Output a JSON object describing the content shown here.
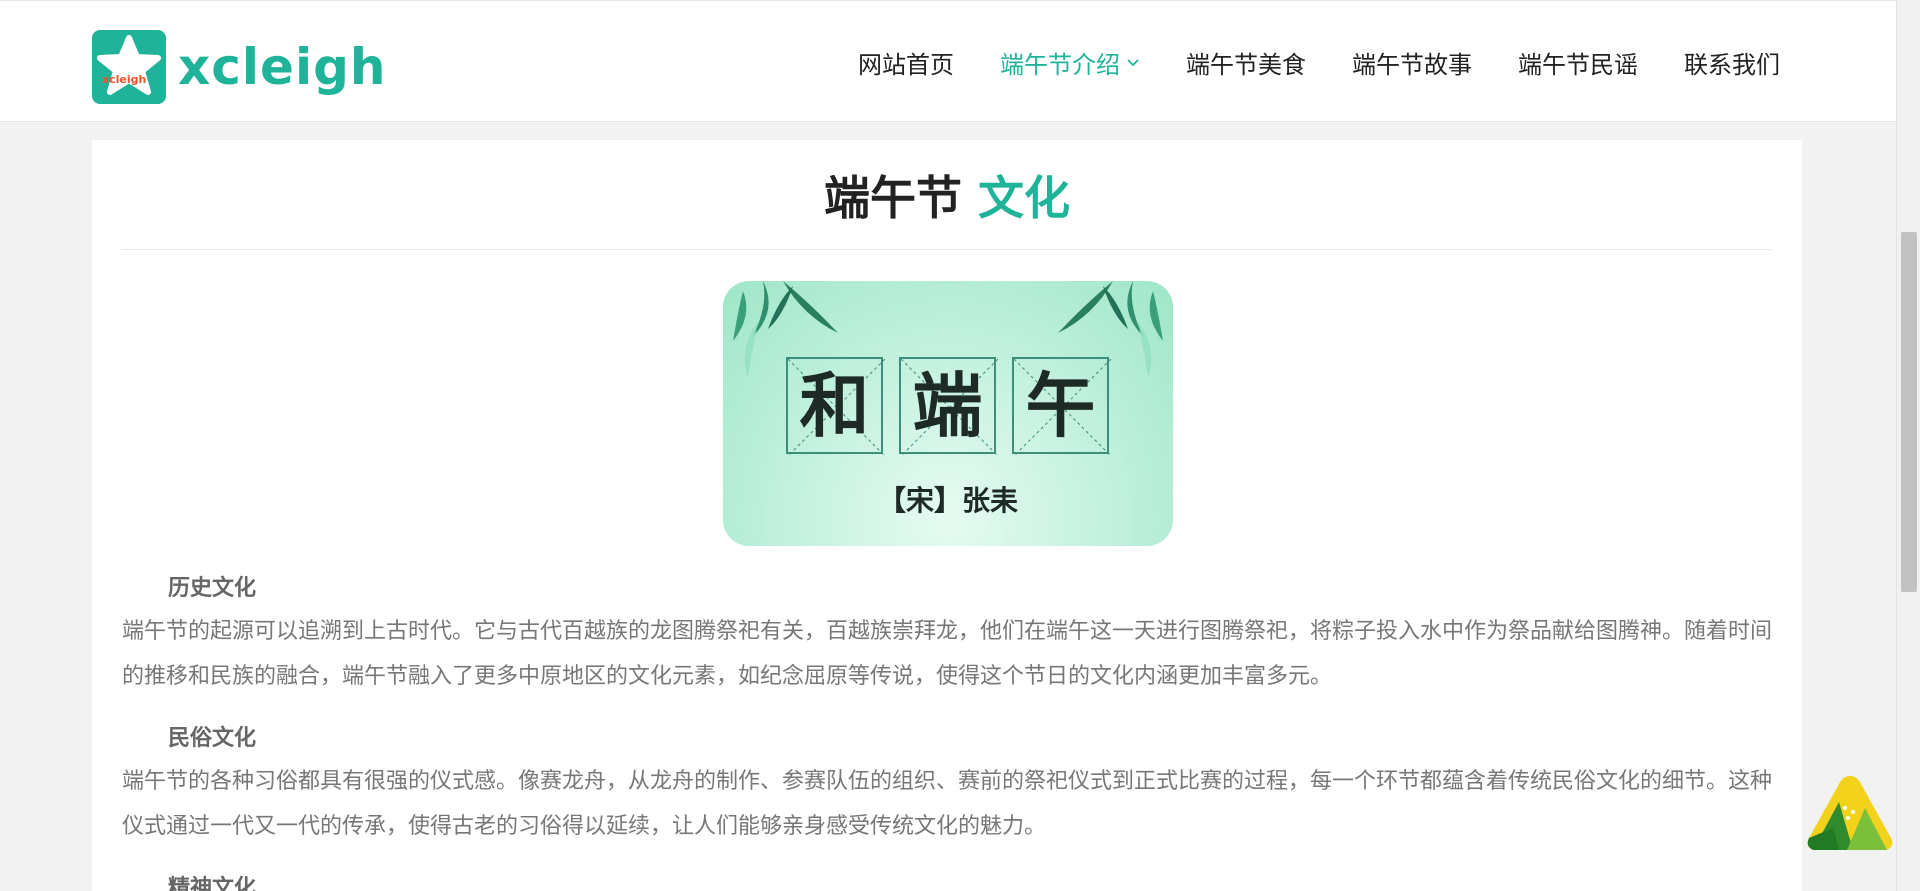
{
  "header": {
    "logo_text": "xcleigh",
    "logo_badge": "xcleigh",
    "nav": [
      {
        "label": "网站首页",
        "active": false
      },
      {
        "label": "端午节介绍",
        "active": true,
        "has_dropdown": true
      },
      {
        "label": "端午节美食",
        "active": false
      },
      {
        "label": "端午节故事",
        "active": false
      },
      {
        "label": "端午节民谣",
        "active": false
      },
      {
        "label": "联系我们",
        "active": false
      }
    ]
  },
  "main": {
    "title_main": "端午节",
    "title_accent": "文化",
    "poster": {
      "chars": [
        "和",
        "端",
        "午"
      ],
      "author": "【宋】张耒"
    },
    "sections": [
      {
        "heading": "历史文化",
        "text": "端午节的起源可以追溯到上古时代。它与古代百越族的龙图腾祭祀有关，百越族崇拜龙，他们在端午这一天进行图腾祭祀，将粽子投入水中作为祭品献给图腾神。随着时间的推移和民族的融合，端午节融入了更多中原地区的文化元素，如纪念屈原等传说，使得这个节日的文化内涵更加丰富多元。"
      },
      {
        "heading": "民俗文化",
        "text": "端午节的各种习俗都具有很强的仪式感。像赛龙舟，从龙舟的制作、参赛队伍的组织、赛前的祭祀仪式到正式比赛的过程，每一个环节都蕴含着传统民俗文化的细节。这种仪式通过一代又一代的传承，使得古老的习俗得以延续，让人们能够亲身感受传统文化的魅力。"
      },
      {
        "heading": "精神文化",
        "text": ""
      }
    ]
  },
  "colors": {
    "accent": "#1fb39a",
    "text_dark": "#222222",
    "text_body": "#777777"
  },
  "icons": [
    "star-logo-icon",
    "chevron-down-icon",
    "zongzi-icon"
  ]
}
